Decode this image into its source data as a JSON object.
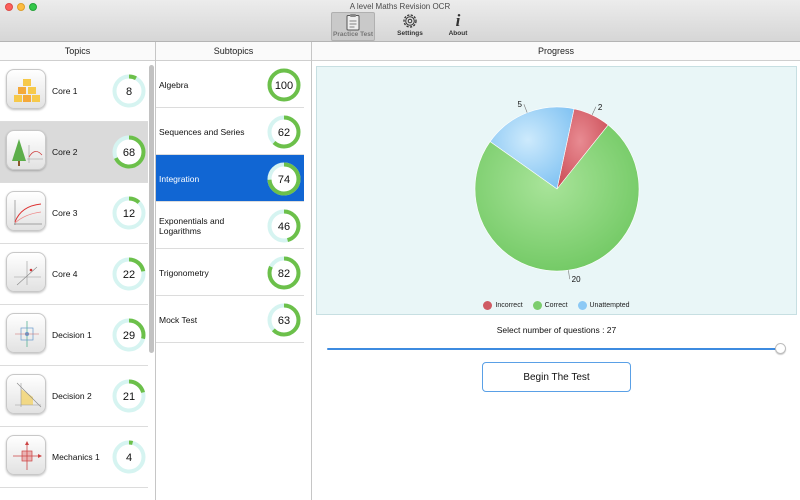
{
  "window": {
    "title": "A level Maths Revision OCR"
  },
  "toolbar": {
    "items": [
      {
        "label": "Practice Test",
        "icon": "clipboard-icon",
        "active": true
      },
      {
        "label": "Settings",
        "icon": "gear-icon",
        "active": false
      },
      {
        "label": "About",
        "icon": "info-icon",
        "active": false
      }
    ]
  },
  "topics": {
    "header": "Topics",
    "items": [
      {
        "name": "Core 1",
        "value": 8
      },
      {
        "name": "Core 2",
        "value": 68
      },
      {
        "name": "Core 3",
        "value": 12
      },
      {
        "name": "Core 4",
        "value": 22
      },
      {
        "name": "Decision 1",
        "value": 29
      },
      {
        "name": "Decision 2",
        "value": 21
      },
      {
        "name": "Mechanics 1",
        "value": 4
      }
    ],
    "selected": "Core 2"
  },
  "subtopics": {
    "header": "Subtopics",
    "items": [
      {
        "name": "Algebra",
        "value": 100
      },
      {
        "name": "Sequences and Series",
        "value": 62
      },
      {
        "name": "Integration",
        "value": 74
      },
      {
        "name": "Exponentials and Logarithms",
        "value": 46
      },
      {
        "name": "Trigonometry",
        "value": 82
      },
      {
        "name": "Mock Test",
        "value": 63
      }
    ],
    "selected": "Integration"
  },
  "progress": {
    "header": "Progress",
    "select_label": "Select number of questions : 27",
    "slider_value": 27,
    "begin_label": "Begin The Test"
  },
  "colors": {
    "accent": "#1166d3",
    "ring_fill": "#6cc04a",
    "ring_track": "#d6f4f1",
    "correct": "#7ccd6e",
    "incorrect": "#cf5b63",
    "unattempted": "#8cc9f5"
  },
  "chart_data": {
    "type": "pie",
    "categories": [
      "Incorrect",
      "Correct",
      "Unattempted"
    ],
    "values": [
      2,
      20,
      5
    ],
    "data_labels": [
      "2",
      "20",
      "5"
    ],
    "legend": "bottom"
  }
}
